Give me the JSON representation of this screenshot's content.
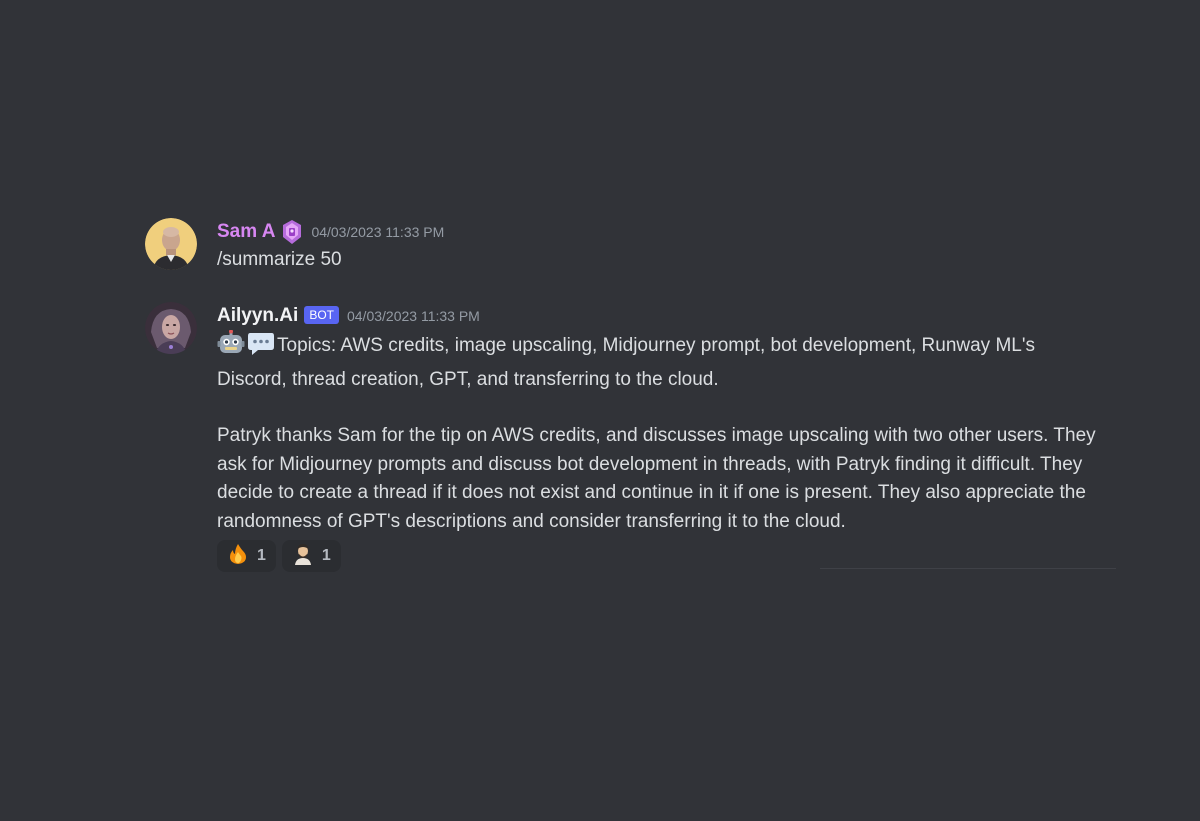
{
  "messages": {
    "sam": {
      "username": "Sam A",
      "timestamp": "04/03/2023 11:33 PM",
      "text": "/summarize 50",
      "role_icon": "gem-badge-icon"
    },
    "bot": {
      "username": "Ailyyn.Ai",
      "tag": "BOT",
      "timestamp": "04/03/2023 11:33 PM",
      "topics": "Topics: AWS credits, image upscaling, Midjourney prompt, bot development, Runway ML's Discord, thread creation, GPT, and transferring to the cloud.",
      "summary": "Patryk thanks Sam for the tip on AWS credits, and discusses image upscaling with two other users. They ask for Midjourney prompts and discuss bot development in threads, with Patryk finding it difficult. They decide to create a thread if it does not exist and continue in it if one is present. They also appreciate the randomness of GPT's descriptions and consider transferring it to the cloud.",
      "emoji_prefix": [
        "robot-emoji",
        "speech-bubble-emoji"
      ],
      "reactions": [
        {
          "emoji": "fire-emoji",
          "count": "1"
        },
        {
          "emoji": "person-emoji",
          "count": "1"
        }
      ]
    }
  },
  "colors": {
    "background": "#313338",
    "sam_name": "#d787f2",
    "bot_tag": "#5865f2",
    "timestamp": "#949ba4",
    "reaction_bg": "#2b2d31"
  }
}
